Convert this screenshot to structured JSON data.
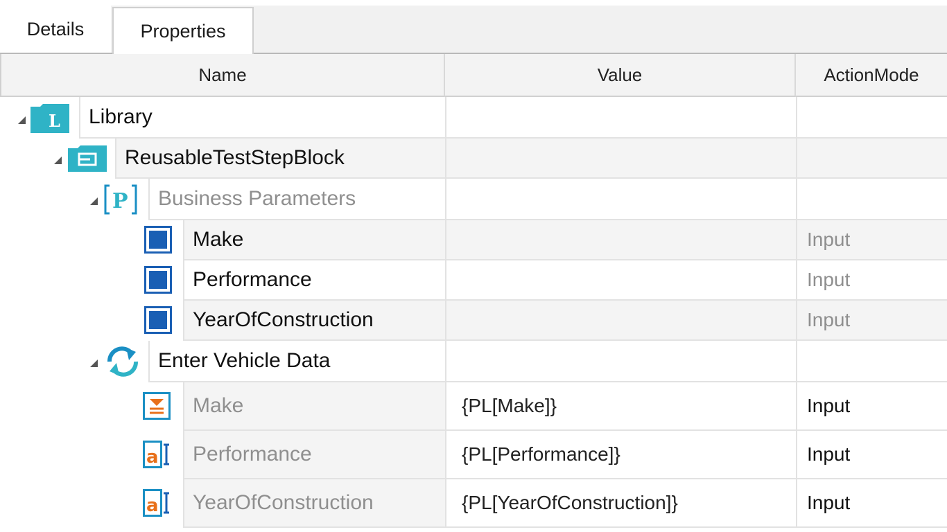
{
  "tabs": [
    {
      "label": "Details"
    },
    {
      "label": "Properties"
    }
  ],
  "columns": {
    "name": "Name",
    "value": "Value",
    "mode": "ActionMode"
  },
  "rows": [
    {
      "name": "Library",
      "value": "",
      "mode": "",
      "icon": "library-icon"
    },
    {
      "name": "ReusableTestStepBlock",
      "value": "",
      "mode": "",
      "icon": "reusable-block-icon"
    },
    {
      "name": "Business Parameters",
      "value": "",
      "mode": "",
      "icon": "business-parameters-icon"
    },
    {
      "name": "Make",
      "value": "",
      "mode": "Input",
      "icon": "parameter-icon"
    },
    {
      "name": "Performance",
      "value": "",
      "mode": "Input",
      "icon": "parameter-icon"
    },
    {
      "name": "YearOfConstruction",
      "value": "",
      "mode": "Input",
      "icon": "parameter-icon"
    },
    {
      "name": "Enter Vehicle Data",
      "value": "",
      "mode": "",
      "icon": "refresh-icon"
    },
    {
      "name": "Make",
      "value": "{PL[Make]}",
      "mode": "Input",
      "icon": "combobox-icon"
    },
    {
      "name": "Performance",
      "value": "{PL[Performance]}",
      "mode": "Input",
      "icon": "textbox-icon"
    },
    {
      "name": "YearOfConstruction",
      "value": "{PL[YearOfConstruction]}",
      "mode": "Input",
      "icon": "textbox-icon"
    }
  ],
  "colors": {
    "teal": "#2fb3c6",
    "blue": "#1a5fb4",
    "orange": "#e8701a",
    "header_bg": "#f3f3f3"
  }
}
